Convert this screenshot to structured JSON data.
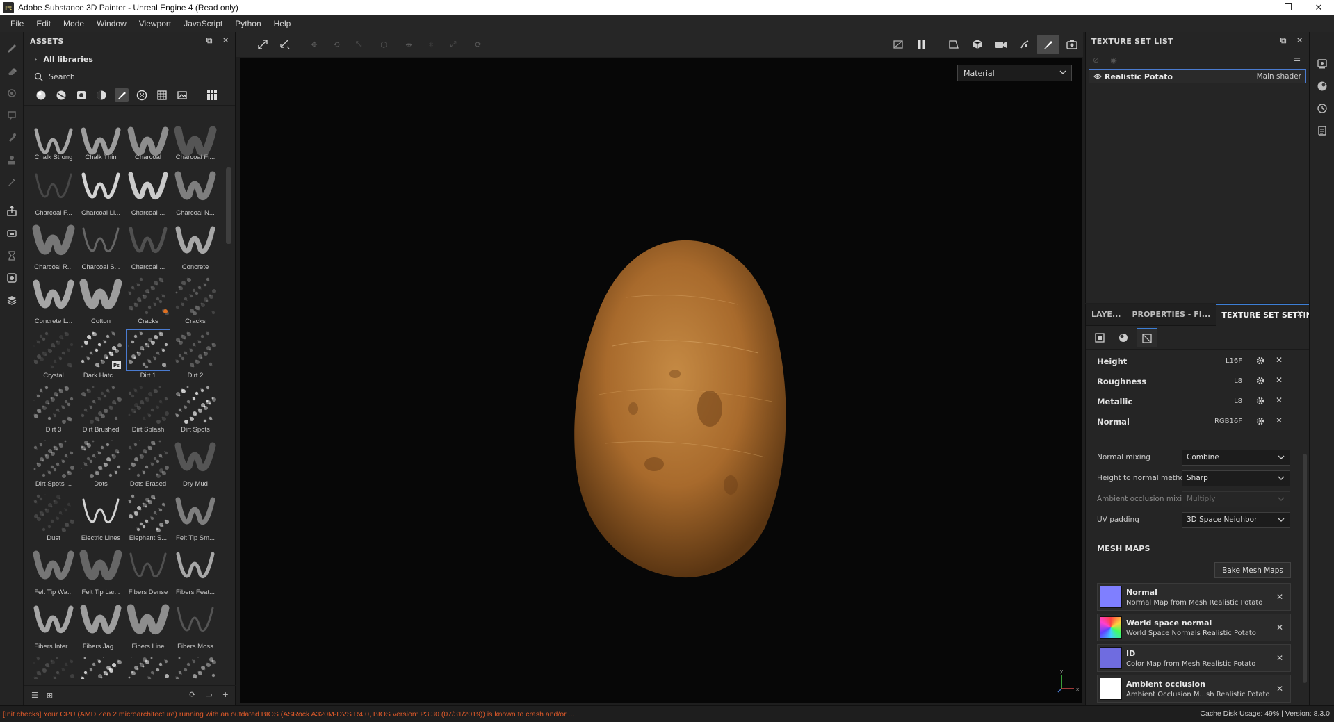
{
  "window": {
    "app_icon_text": "Pt",
    "title": "Adobe Substance 3D Painter - Unreal Engine 4 (Read only)",
    "minimize": "—",
    "maximize": "❐",
    "close": "✕"
  },
  "menu": [
    "File",
    "Edit",
    "Mode",
    "Window",
    "Viewport",
    "JavaScript",
    "Python",
    "Help"
  ],
  "assets": {
    "title": "ASSETS",
    "libraries": "All libraries",
    "search_placeholder": "Search",
    "first_row": [
      "Chalk Strong",
      "Chalk Thin",
      "Charcoal",
      "Charcoal Fi..."
    ],
    "rows": [
      [
        "Charcoal F...",
        "Charcoal Li...",
        "Charcoal ...",
        "Charcoal N..."
      ],
      [
        "Charcoal R...",
        "Charcoal S...",
        "Charcoal ...",
        "Concrete"
      ],
      [
        "Concrete L...",
        "Cotton",
        "Cracks",
        "Cracks"
      ],
      [
        "Crystal",
        "Dark Hatc...",
        "Dirt 1",
        "Dirt 2"
      ],
      [
        "Dirt 3",
        "Dirt Brushed",
        "Dirt Splash",
        "Dirt Spots"
      ],
      [
        "Dirt Spots ...",
        "Dots",
        "Dots Erased",
        "Dry Mud"
      ],
      [
        "Dust",
        "Electric Lines",
        "Elephant S...",
        "Felt Tip Sm..."
      ],
      [
        "Felt Tip Wa...",
        "Felt Tip Lar...",
        "Fibers Dense",
        "Fibers Feat..."
      ],
      [
        "Fibers Inter...",
        "Fibers Jag...",
        "Fibers Line",
        "Fibers Moss"
      ],
      [
        "",
        "",
        "",
        ""
      ]
    ],
    "ps_badge": "Ps",
    "selected_asset": "Dirt 1"
  },
  "viewport": {
    "material_mode": "Material"
  },
  "texture_set_list": {
    "title": "TEXTURE SET LIST",
    "item_name": "Realistic Potato",
    "item_shader": "Main shader"
  },
  "tss": {
    "tabs": [
      "LAYE...",
      "PROPERTIES - FI...",
      "TEXTURE SET SETTIN..."
    ],
    "channels": [
      {
        "name": "Height",
        "format": "L16F"
      },
      {
        "name": "Roughness",
        "format": "L8"
      },
      {
        "name": "Metallic",
        "format": "L8"
      },
      {
        "name": "Normal",
        "format": "RGB16F"
      }
    ],
    "settings": [
      {
        "label": "Normal mixing",
        "value": "Combine",
        "disabled": false
      },
      {
        "label": "Height to normal method",
        "value": "Sharp",
        "disabled": false
      },
      {
        "label": "Ambient occlusion mixing",
        "value": "Multiply",
        "disabled": true
      },
      {
        "label": "UV padding",
        "value": "3D Space Neighbor",
        "disabled": false
      }
    ],
    "mesh_maps_title": "MESH MAPS",
    "bake_button": "Bake Mesh Maps",
    "mesh_maps": [
      {
        "title": "Normal",
        "sub": "Normal Map from Mesh Realistic Potato",
        "color": "#7f7fff"
      },
      {
        "title": "World space normal",
        "sub": "World Space Normals Realistic Potato",
        "color": "rainbow"
      },
      {
        "title": "ID",
        "sub": "Color Map from Mesh Realistic Potato",
        "color": "#6f6ce0"
      },
      {
        "title": "Ambient occlusion",
        "sub": "Ambient Occlusion M...sh Realistic Potato",
        "color": "#ffffff"
      }
    ]
  },
  "status": {
    "message": "[Init checks] Your CPU (AMD Zen 2 microarchitecture) running with an outdated BIOS (ASRock A320M-DVS R4.0, BIOS version: P3.30 (07/31/2019)) is known to crash and/or ...",
    "cache": "Cache Disk Usage:",
    "cache_value": "49%",
    "version": "Version: 8.3.0"
  },
  "colors": {
    "accent": "#3d7fd6",
    "warning": "#e05a2a",
    "potato_base": "#b97a35"
  }
}
